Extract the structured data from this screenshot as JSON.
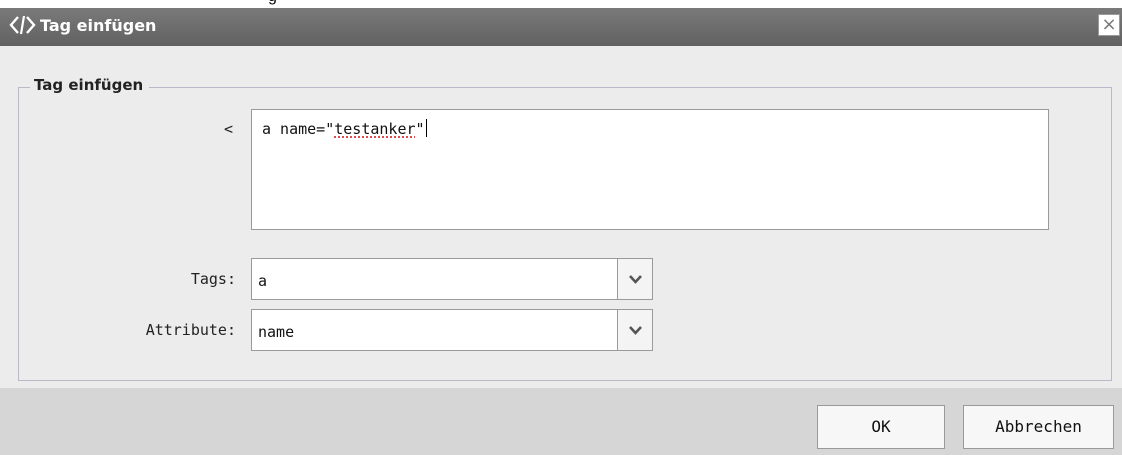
{
  "page_top_fragment": "g",
  "window": {
    "title": "Tag einfügen",
    "close_glyph": "×"
  },
  "fieldset": {
    "legend": "Tag einfügen"
  },
  "tag_input": {
    "prefix_label": "<",
    "value_before": "a name=\"",
    "value_misspelled": "testanker",
    "value_after": "\""
  },
  "tags_field": {
    "label": "Tags:",
    "value": "a"
  },
  "attribute_field": {
    "label": "Attribute:",
    "value": "name"
  },
  "buttons": {
    "ok": "OK",
    "cancel": "Abbrechen"
  },
  "icons": {
    "title": "code-brackets-icon",
    "close": "close-icon",
    "dropdown": "chevron-down-icon"
  }
}
